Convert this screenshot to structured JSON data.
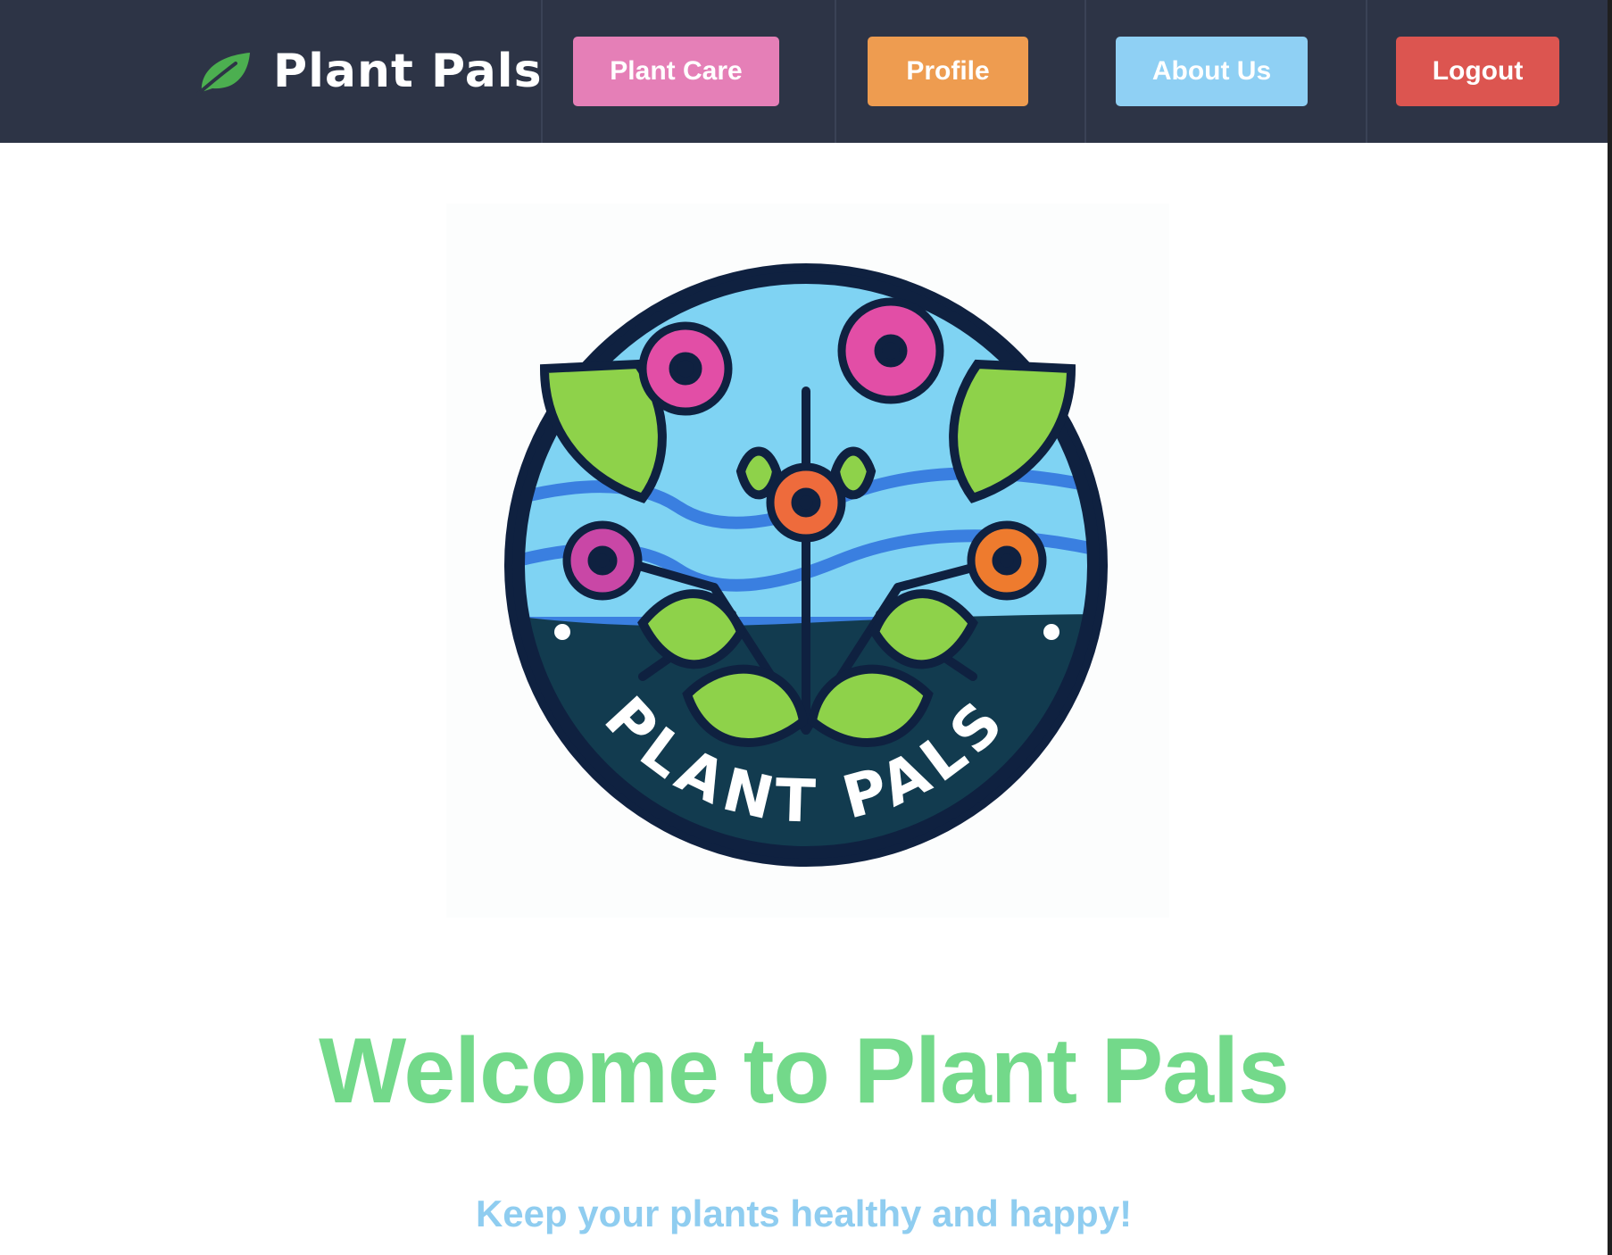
{
  "navbar": {
    "brand": "Plant Pals",
    "buttons": {
      "plant_care": "Plant Care",
      "profile": "Profile",
      "about_us": "About Us",
      "logout": "Logout"
    }
  },
  "logo": {
    "text": "PLANT PALS"
  },
  "hero": {
    "title": "Welcome to Plant Pals",
    "subtitle": "Keep your plants healthy and happy!"
  },
  "colors": {
    "navbar_bg": "#2d3446",
    "plant_care": "#e57fb7",
    "profile": "#ee9c50",
    "about_us": "#8fd0f4",
    "logout": "#dc5550",
    "title": "#73d98a",
    "subtitle": "#8fcdf0"
  },
  "icons": {
    "brand": "leaf-icon"
  }
}
